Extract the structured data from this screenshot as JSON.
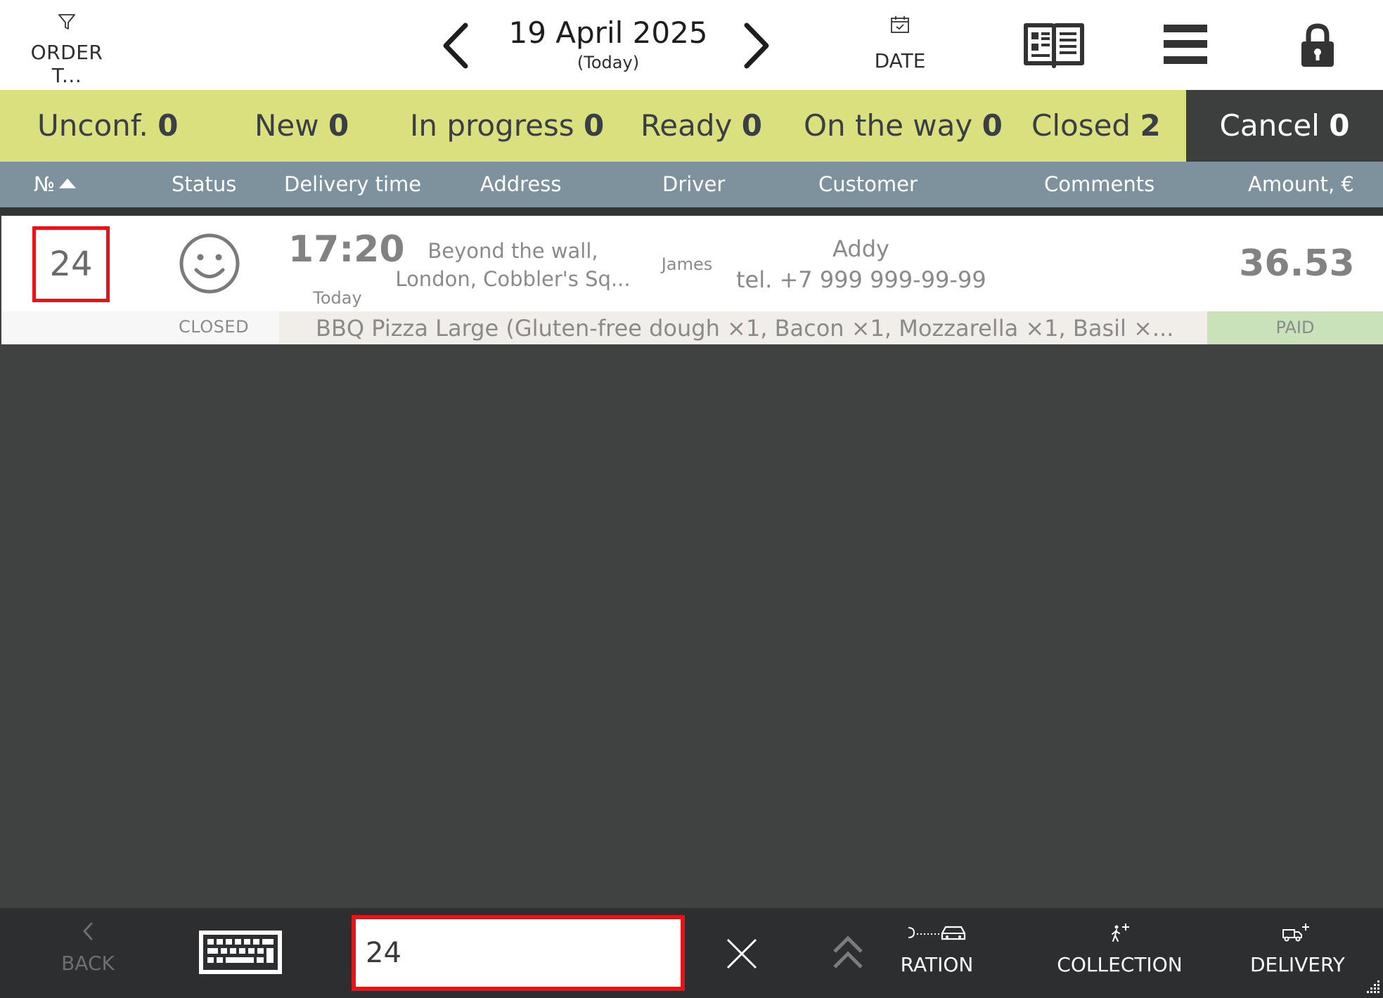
{
  "header": {
    "order_type_label": "ORDER T...",
    "date_main": "19 April 2025",
    "date_sub": "(Today)",
    "date_button_label": "DATE",
    "icons": {
      "filter": "filter-icon",
      "prev": "chevron-left-icon",
      "next": "chevron-right-icon",
      "calendar": "calendar-icon",
      "menu_book": "menu-book-icon",
      "hamburger": "hamburger-icon",
      "lock": "lock-icon"
    }
  },
  "tabs": [
    {
      "label": "Unconf.",
      "count": "0"
    },
    {
      "label": "New",
      "count": "0"
    },
    {
      "label": "In progress",
      "count": "0"
    },
    {
      "label": "Ready",
      "count": "0"
    },
    {
      "label": "On the way",
      "count": "0"
    },
    {
      "label": "Closed",
      "count": "2"
    },
    {
      "label": "Cancel",
      "count": "0"
    }
  ],
  "columns": [
    "№",
    "Status",
    "Delivery time",
    "Address",
    "Driver",
    "Customer",
    "Comments",
    "Amount, €"
  ],
  "orders": [
    {
      "number": "24",
      "status": "CLOSED",
      "delivery_time": "17:20",
      "delivery_day": "Today",
      "address_line1": "Beyond the wall,",
      "address_line2": "London, Cobbler's Sq...",
      "driver": "James",
      "customer_name": "Addy",
      "customer_tel": "tel. +7 999 999-99-99",
      "comments": "",
      "items": "BBQ Pizza Large (Gluten-free dough ×1, Bacon ×1, Mozzarella ×1, Basil ×...",
      "amount": "36.53",
      "payment": "PAID"
    }
  ],
  "footer": {
    "back_label": "BACK",
    "search_value": "24",
    "aggregation_label": "RATION",
    "collection_label": "COLLECTION",
    "delivery_label": "DELIVERY",
    "icons": {
      "back": "chevron-left-icon",
      "keyboard": "keyboard-icon",
      "clear": "close-icon",
      "up": "double-chevron-up-icon",
      "aggregation": "car-route-icon",
      "collection": "walking-person-plus-icon",
      "delivery": "truck-plus-icon"
    }
  },
  "colors": {
    "tab_bar": "#dbe07f",
    "column_header": "#7d929d",
    "background": "#404241",
    "highlight": "#e41419",
    "paid": "#c9e2b9"
  }
}
